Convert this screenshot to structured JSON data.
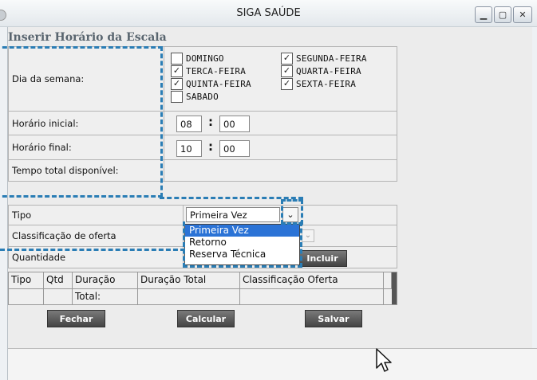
{
  "window": {
    "title": "SIGA SAÚDE"
  },
  "section_title": "Inserir Horário da Escala",
  "form": {
    "dia_semana_label": "Dia da semana:",
    "days": [
      {
        "label": "DOMINGO",
        "checked": false
      },
      {
        "label": "SEGUNDA-FEIRA",
        "checked": true
      },
      {
        "label": "TERCA-FEIRA",
        "checked": true
      },
      {
        "label": "QUARTA-FEIRA",
        "checked": true
      },
      {
        "label": "QUINTA-FEIRA",
        "checked": true
      },
      {
        "label": "SEXTA-FEIRA",
        "checked": true
      },
      {
        "label": "SABADO",
        "checked": false
      }
    ],
    "horario_inicial_label": "Horário inicial:",
    "horario_inicial_h": "08",
    "horario_inicial_m": "00",
    "horario_final_label": "Horário final:",
    "horario_final_h": "10",
    "horario_final_m": "00",
    "time_separator": ":",
    "tempo_total_label": "Tempo total disponível:",
    "tipo_label": "Tipo",
    "tipo_value": "Primeira Vez",
    "tipo_options": [
      "Primeira Vez",
      "Retorno",
      "Reserva Técnica"
    ],
    "classificacao_label": "Classificação de oferta",
    "quantidade_label": "Quantidade",
    "incluir_label": "Incluir"
  },
  "grid": {
    "headers": [
      "Tipo",
      "Qtd",
      "Duração",
      "Duração Total",
      "Classificação Oferta"
    ],
    "total_label": "Total:"
  },
  "buttons": {
    "fechar": "Fechar",
    "calcular": "Calcular",
    "salvar": "Salvar"
  },
  "icons": {
    "minimize": "minimize-icon",
    "maximize": "maximize-icon",
    "close": "close-icon",
    "dropdown": "chevron-down-icon",
    "cursor": "mouse-pointer-icon"
  },
  "colors": {
    "highlight": "#2a7db5",
    "selected_option": "#2b73d6"
  }
}
